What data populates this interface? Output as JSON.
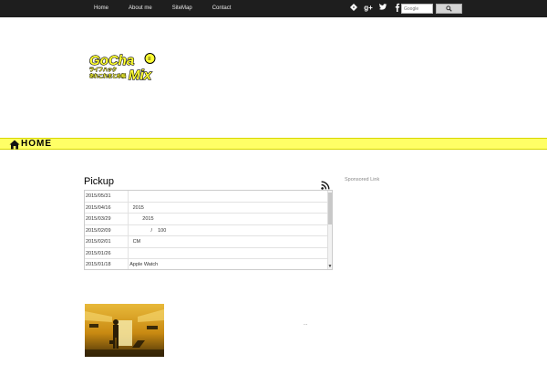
{
  "nav": {
    "items": [
      {
        "label": "Home"
      },
      {
        "label": "About me"
      },
      {
        "label": "SiteMap"
      },
      {
        "label": "Contact"
      }
    ]
  },
  "search": {
    "placeholder": "Google",
    "button_icon": "search-icon"
  },
  "social": [
    "feedly-icon",
    "google-plus-icon",
    "twitter-icon",
    "facebook-icon"
  ],
  "logo": {
    "line1": "GoCha",
    "line2": "Mix",
    "tagline1": "ライフハック",
    "tagline2": "あれこれまとめ帳"
  },
  "breadcrumb": {
    "home_label": "HOME"
  },
  "pickup": {
    "title": "Pickup",
    "rows": [
      {
        "date": "2015/05/31",
        "title": ""
      },
      {
        "date": "2015/04/16",
        "title": "   2015"
      },
      {
        "date": "2015/03/29",
        "title": "          2015"
      },
      {
        "date": "2015/02/09",
        "title": "                /    100"
      },
      {
        "date": "2015/02/01",
        "title": "   CM"
      },
      {
        "date": "2015/01/26",
        "title": ""
      },
      {
        "date": "2015/01/18",
        "title": " Apple Watch"
      }
    ]
  },
  "sidebar": {
    "sponsored_label": "Sponsored Link"
  },
  "article": {
    "ellipsis": "..."
  },
  "colors": {
    "topbar": "#1e1e1e",
    "accent_yellow": "#ffff66"
  }
}
